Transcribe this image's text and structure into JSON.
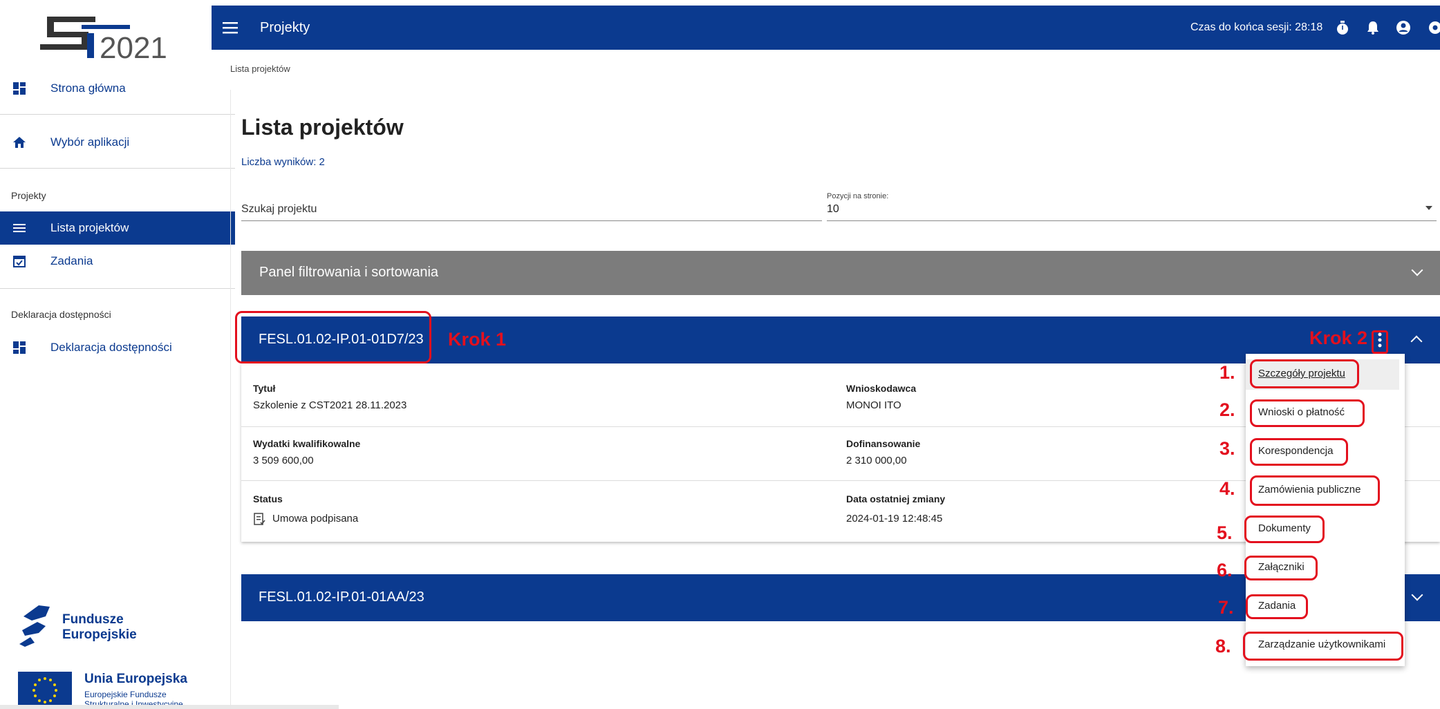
{
  "app": {
    "logo_text": "2021",
    "logo_alt": "CST2021"
  },
  "sidebar": {
    "items": [
      {
        "label": "Strona główna",
        "icon": "dashboard-icon"
      },
      {
        "label": "Wybór aplikacji",
        "icon": "home-icon"
      },
      {
        "label": "Lista projektów",
        "icon": "list-icon"
      },
      {
        "label": "Zadania",
        "icon": "calendar-check-icon"
      },
      {
        "label": "Deklaracja dostępności",
        "icon": "dashboard-icon"
      }
    ],
    "section_projekty": "Projekty",
    "section_deklaracja": "Deklaracja dostępności",
    "fe_logo_line1": "Fundusze",
    "fe_logo_line2": "Europejskie",
    "ue_title": "Unia Europejska",
    "ue_sub_line1": "Europejskie Fundusze",
    "ue_sub_line2": "Strukturalne i Inwestycyjne"
  },
  "topbar": {
    "title": "Projekty",
    "session_label": "Czas do końca sesji: 28:18",
    "accent": "#0b3a8f"
  },
  "breadcrumb": "Lista projektów",
  "page": {
    "title": "Lista projektów",
    "results": "Liczba wyników: 2"
  },
  "search": {
    "placeholder": "Szukaj projektu"
  },
  "perpage": {
    "label": "Pozycji na stronie:",
    "value": "10"
  },
  "filter_panel": {
    "label": "Panel filtrowania i sortowania"
  },
  "projects": [
    {
      "id": "FESL.01.02-IP.01-01D7/23",
      "tytul_label": "Tytuł",
      "tytul": "Szkolenie z CST2021 28.11.2023",
      "wnioskodawca_label": "Wnioskodawca",
      "wnioskodawca": "MONOI ITO",
      "wydatki_label": "Wydatki kwalifikowalne",
      "wydatki": "3 509 600,00",
      "dofin_label": "Dofinansowanie",
      "dofin": "2 310 000,00",
      "status_label": "Status",
      "status": "Umowa podpisana",
      "data_label": "Data ostatniej zmiany",
      "data": "2024-01-19 12:48:45"
    },
    {
      "id": "FESL.01.02-IP.01-01AA/23"
    }
  ],
  "context_menu": {
    "items": [
      "Szczegóły projektu",
      "Wnioski o płatność",
      "Korespondencja",
      "Zamówienia publiczne",
      "Dokumenty",
      "Załączniki",
      "Zadania",
      "Zarządzanie użytkownikami"
    ],
    "numbers": [
      "1.",
      "2.",
      "3.",
      "4.",
      "5.",
      "6.",
      "7.",
      "8."
    ]
  },
  "annotations": {
    "step1": "Krok 1",
    "step2": "Krok 2",
    "color": "#e3101e"
  }
}
